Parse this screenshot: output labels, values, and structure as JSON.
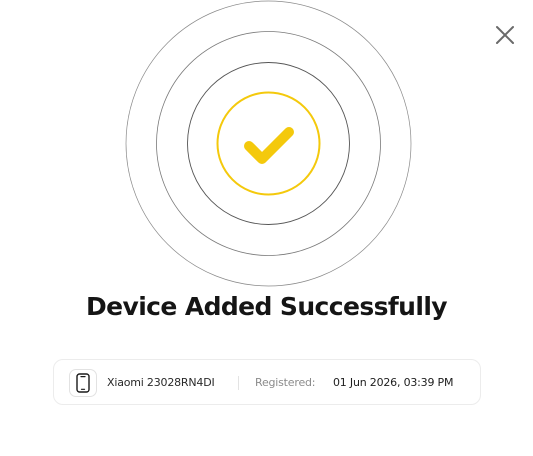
{
  "dialog": {
    "close_icon": "close-icon",
    "success_icon": "checkmark-icon",
    "title": "Device Added Successfully",
    "colors": {
      "accent": "#F4C90C",
      "ring": "#6e6e6e",
      "text": "#151515",
      "muted": "#8b8b8b"
    }
  },
  "device": {
    "icon": "smartphone-icon",
    "name": "Xiaomi 23028RN4DI",
    "registered_label": "Registered:",
    "registered_value": "01 Jun 2026, 03:39 PM"
  }
}
